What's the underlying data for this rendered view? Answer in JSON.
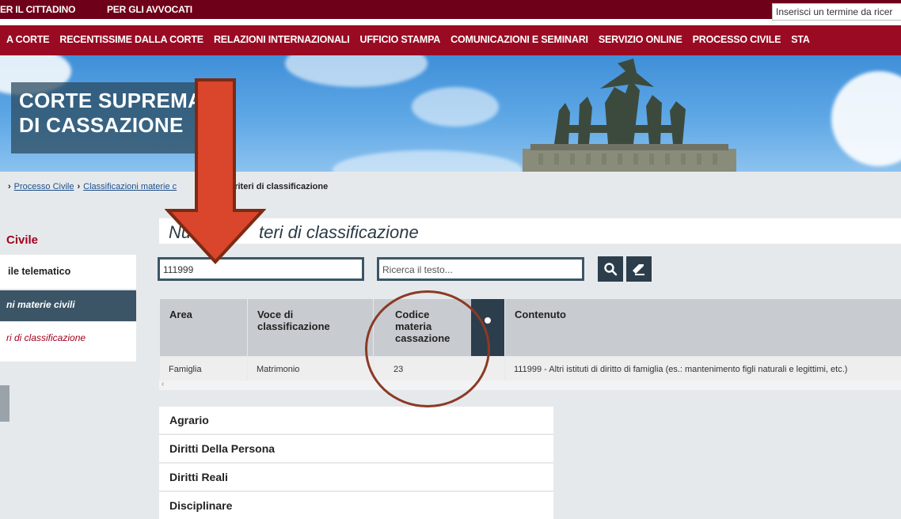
{
  "topbar": {
    "links": [
      "ER IL CITTADINO",
      "PER GLI AVVOCATI"
    ],
    "search_placeholder": "Inserisci un termine da ricer"
  },
  "nav": {
    "items": [
      "A CORTE",
      "RECENTISSIME DALLA CORTE",
      "RELAZIONI INTERNAZIONALI",
      "UFFICIO STAMPA",
      "COMUNICAZIONI E SEMINARI",
      "SERVIZIO ONLINE",
      "PROCESSO CIVILE",
      "STA"
    ]
  },
  "banner": {
    "title_line1": "CORTE SUPREMA",
    "title_line2": "DI CASSAZIONE"
  },
  "breadcrumb": {
    "link1": "Processo Civile",
    "link2": "Classificazioni materie c",
    "current": "ovi criteri di classificazione"
  },
  "sidebar": {
    "title": "Civile",
    "items": [
      {
        "label": "ile telematico"
      },
      {
        "label": "ni materie civili"
      },
      {
        "label": "ri di classificazione"
      }
    ]
  },
  "main": {
    "heading_part1": "Nu",
    "heading_part2": "teri di classificazione",
    "search": {
      "code_value": "111999",
      "text_placeholder": "Ricerca il testo..."
    },
    "table": {
      "headers": [
        "Area",
        "Voce di classificazione",
        "Codice materia cassazione",
        "Contenuto"
      ],
      "rows": [
        [
          "Famiglia",
          "Matrimonio",
          "23",
          "111999 - Altri istituti di diritto di famiglia (es.: mantenimento figli naturali e legittimi, etc.)"
        ]
      ],
      "scroll_left": "‹"
    },
    "accordion": [
      "Agrario",
      "Diritti Della Persona",
      "Diritti Reali",
      "Disciplinare"
    ]
  },
  "colors": {
    "topbar": "#6f0019",
    "nav": "#9a0b23",
    "accent_dark": "#2c3e4c",
    "annotation_arrow": "#d9462b",
    "annotation_circle": "#8b3a25"
  }
}
